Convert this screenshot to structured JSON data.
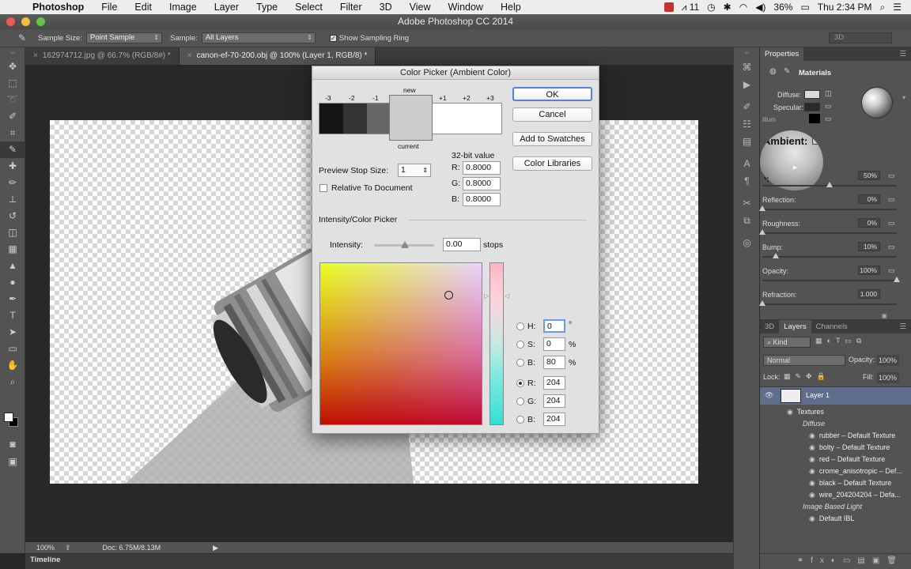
{
  "menubar": {
    "items": [
      "Photoshop",
      "File",
      "Edit",
      "Image",
      "Layer",
      "Type",
      "Select",
      "Filter",
      "3D",
      "View",
      "Window",
      "Help"
    ],
    "status_count": "11",
    "battery": "36%",
    "clock": "Thu 2:34 PM"
  },
  "window": {
    "title": "Adobe Photoshop CC 2014"
  },
  "options": {
    "sample_size_label": "Sample Size:",
    "sample_size_value": "Point Sample",
    "sample_label": "Sample:",
    "sample_value": "All Layers",
    "sampling_ring_label": "Show Sampling Ring",
    "workspace": "3D"
  },
  "tabs": [
    {
      "label": "162974712.jpg @ 66.7% (RGB/8#) *"
    },
    {
      "label": "canon-ef-70-200.obj @ 100% (Layer 1, RGB/8) *"
    }
  ],
  "status": {
    "zoom": "100%",
    "doc": "Doc: 6.75M/8.13M",
    "timeline": "Timeline"
  },
  "properties": {
    "tab": "Properties",
    "section": "Materials",
    "diffuse_label": "Diffuse:",
    "specular_label": "Specular:",
    "illum_label": "Illum",
    "ambient_label": "Ambient:",
    "shine_label": "e:",
    "rows": [
      {
        "label": "",
        "value": "50%",
        "level": 50
      },
      {
        "label": "Reflection:",
        "value": "0%",
        "level": 0
      },
      {
        "label": "Roughness:",
        "value": "0%",
        "level": 0
      },
      {
        "label": "Bump:",
        "value": "10%",
        "level": 10
      },
      {
        "label": "Opacity:",
        "value": "100%",
        "level": 100
      },
      {
        "label": "Refraction:",
        "value": "1.000",
        "level": 0
      }
    ]
  },
  "layers": {
    "tabs": [
      "3D",
      "Layers",
      "Channels"
    ],
    "kind": "Kind",
    "blend_mode": "Normal",
    "opacity_label": "Opacity:",
    "opacity_value": "100%",
    "lock_label": "Lock:",
    "fill_label": "Fill:",
    "fill_value": "100%",
    "layer_name": "Layer 1",
    "textures_label": "Textures",
    "diffuse_label": "Diffuse",
    "textures": [
      "rubber – Default Texture",
      "bolty – Default Texture",
      "red – Default Texture",
      "crome_anisotropic – Def...",
      "black – Default Texture",
      "wire_204204204 – Defa..."
    ],
    "ibl_label": "Image Based Light",
    "ibl_item": "Default IBL"
  },
  "dialog": {
    "title": "Color Picker (Ambient Color)",
    "new_label": "new",
    "current_label": "current",
    "stops": [
      "-3",
      "-2",
      "-1",
      "+1",
      "+2",
      "+3"
    ],
    "buttons": {
      "ok": "OK",
      "cancel": "Cancel",
      "swatches": "Add to Swatches",
      "libraries": "Color Libraries"
    },
    "bit_label": "32-bit value",
    "bit_r_label": "R:",
    "bit_r": "0.8000",
    "bit_g_label": "G:",
    "bit_g": "0.8000",
    "bit_b_label": "B:",
    "bit_b": "0.8000",
    "preview_stop_label": "Preview Stop Size:",
    "preview_stop_value": "1",
    "relative_label": "Relative To Document",
    "intensity_section": "Intensity/Color Picker",
    "intensity_label": "Intensity:",
    "intensity_value": "0.00",
    "stops_unit": "stops",
    "h_label": "H:",
    "h": "0",
    "h_unit": "°",
    "s_label": "S:",
    "s": "0",
    "s_unit": "%",
    "b_label": "B:",
    "b": "80",
    "b_unit": "%",
    "r_label": "R:",
    "r": "204",
    "g_label": "G:",
    "g": "204",
    "bb_label": "B:",
    "bb": "204",
    "colors": {
      "new": "#cccccc",
      "current": "#cccccc"
    }
  }
}
